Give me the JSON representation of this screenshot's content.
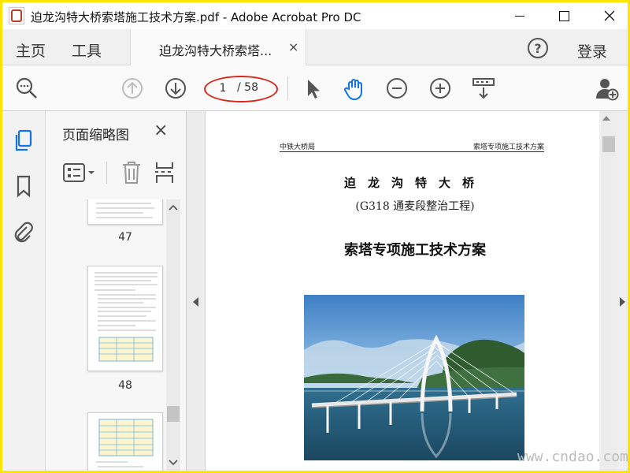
{
  "window": {
    "title": "迫龙沟特大桥索塔施工技术方案.pdf - Adobe Acrobat Pro DC"
  },
  "tabs": {
    "home": "主页",
    "tools": "工具",
    "document_tab": "迫龙沟特大桥索塔...",
    "document_tab_close": "×",
    "help": "?",
    "login": "登录"
  },
  "toolbar": {
    "current_page": "1",
    "total_pages": "/ 58"
  },
  "panel": {
    "title": "页面缩略图",
    "close": "×",
    "thumbnails": [
      {
        "label": "47"
      },
      {
        "label": "48"
      }
    ]
  },
  "document": {
    "header_left": "中铁大桥局",
    "header_right": "索塔专项施工技术方案",
    "title": "迫龙沟特大桥",
    "subtitle": "(G318 通麦段整治工程)",
    "heading": "索塔专项施工技术方案"
  },
  "watermark": "www.cndao.com",
  "colors": {
    "frame": "#ffe400",
    "highlight_ellipse": "#d9281e",
    "accent_blue": "#1473e6"
  }
}
